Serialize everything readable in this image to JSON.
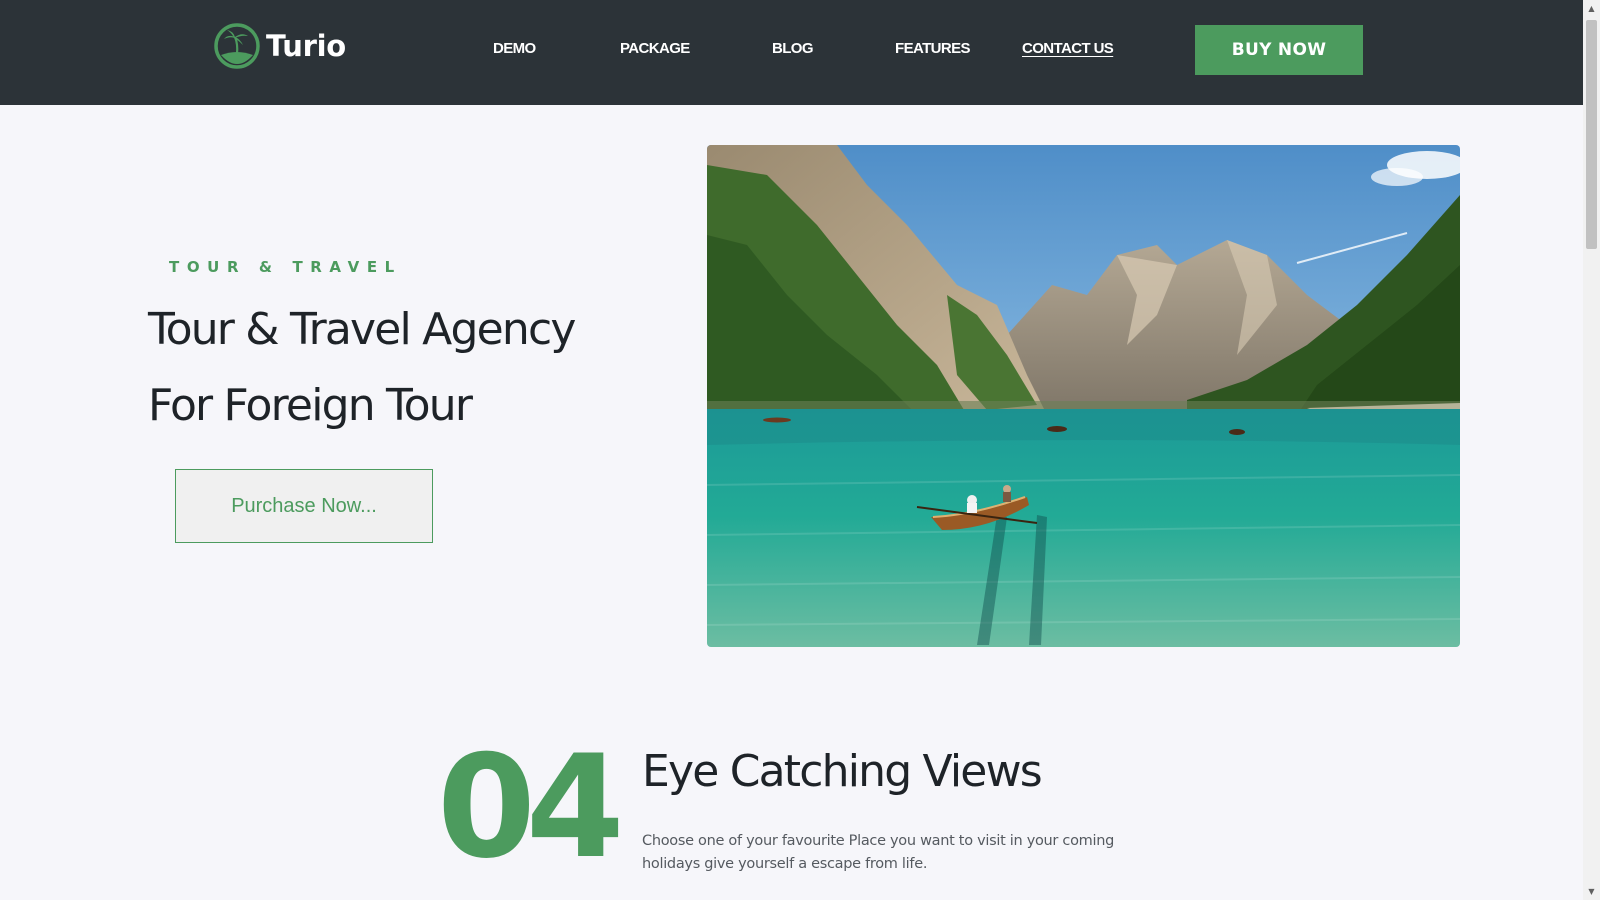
{
  "brand": {
    "name": "Turio",
    "logo_icon": "palm-island-logo-icon",
    "accent_color": "#4c9b5e",
    "header_color": "#2c3338"
  },
  "nav": {
    "items": [
      {
        "label": "DEMO",
        "active": false
      },
      {
        "label": "PACKAGE",
        "active": false
      },
      {
        "label": "BLOG",
        "active": false
      },
      {
        "label": "FEATURES",
        "active": false
      },
      {
        "label": "CONTACT US",
        "active": true
      }
    ],
    "cta_label": "BUY NOW"
  },
  "hero": {
    "eyebrow": "TOUR & TRAVEL",
    "title_line1": "Tour & Travel Agency",
    "title_line2": "For Foreign Tour",
    "button_label": "Purchase Now...",
    "image_subject": "mountain-lake-rowboat-photo"
  },
  "feature": {
    "number": "04",
    "title": "Eye Catching Views",
    "description": "Choose one of your favourite Place you want to visit in your coming holidays give yourself a escape from life."
  },
  "scrollbar": {
    "up_icon": "▲",
    "down_icon": "▼"
  }
}
